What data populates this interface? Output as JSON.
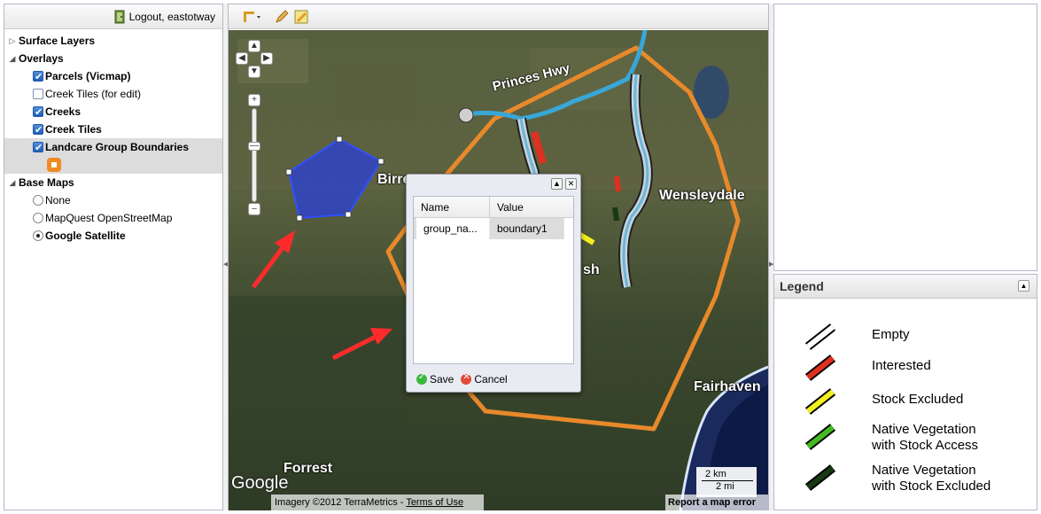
{
  "left_panel": {
    "logout_label": "Logout, eastotway",
    "tree": {
      "surface_layers": "Surface Layers",
      "overlays": "Overlays",
      "overlay_items": [
        {
          "label": "Parcels (Vicmap)",
          "checked": true
        },
        {
          "label": "Creek Tiles (for edit)",
          "checked": false
        },
        {
          "label": "Creeks",
          "checked": true
        },
        {
          "label": "Creek Tiles",
          "checked": true
        },
        {
          "label": "Landcare Group Boundaries",
          "checked": true
        }
      ],
      "base_maps": "Base Maps",
      "base_map_items": [
        {
          "label": "None",
          "selected": false
        },
        {
          "label": "MapQuest OpenStreetMap",
          "selected": false
        },
        {
          "label": "Google Satellite",
          "selected": true
        }
      ]
    }
  },
  "map": {
    "place_labels": {
      "princes_hwy": "Princes Hwy",
      "birregurra": "Birre",
      "wensleydale": "Wensleydale",
      "sh": "sh",
      "fairhaven": "Fairhaven",
      "forrest": "Forrest"
    },
    "google_logo": "Google",
    "imagery_credit": "Imagery ©2012 TerraMetrics - ",
    "terms_link": "Terms of Use",
    "report_error": "Report a map error",
    "scale_km": "2 km",
    "scale_mi": "2 mi"
  },
  "popup": {
    "columns": [
      "Name",
      "Value"
    ],
    "rows": [
      {
        "name": "group_na...",
        "value": "boundary1"
      }
    ],
    "save_label": "Save",
    "cancel_label": "Cancel"
  },
  "legend": {
    "title": "Legend",
    "items": [
      {
        "line1": "Empty",
        "line2": "",
        "color": "#ffffff"
      },
      {
        "line1": "Interested",
        "line2": "",
        "color": "#e03020"
      },
      {
        "line1": "Stock Excluded",
        "line2": "",
        "color": "#f2f020"
      },
      {
        "line1": "Native Vegetation",
        "line2": "with Stock Access",
        "color": "#44bb22"
      },
      {
        "line1": "Native Vegetation",
        "line2": "with Stock Excluded",
        "color": "#173a12"
      }
    ]
  },
  "colors": {
    "polygon_fill": "#2a3fd8",
    "boundary_orange": "#e8892a",
    "creek_blue": "#39a7d6",
    "arrow_red": "#ff2b2b"
  }
}
